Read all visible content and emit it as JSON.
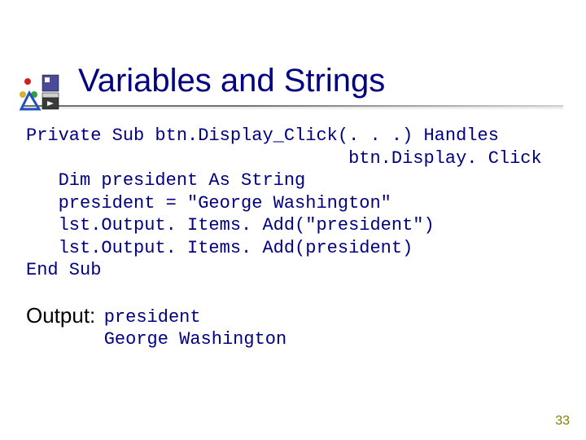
{
  "slide": {
    "title": "Variables and Strings",
    "page_number": "33"
  },
  "code": {
    "line1": "Private Sub btn.Display_Click(. . .) Handles",
    "line2": "                              btn.Display. Click",
    "line3": "   Dim president As String",
    "line4": "   president = \"George Washington\"",
    "line5": "   lst.Output. Items. Add(\"president\")",
    "line6": "   lst.Output. Items. Add(president)",
    "line7": "End Sub"
  },
  "output": {
    "label": "Output:",
    "line1": "president",
    "line2": "George Washington"
  }
}
